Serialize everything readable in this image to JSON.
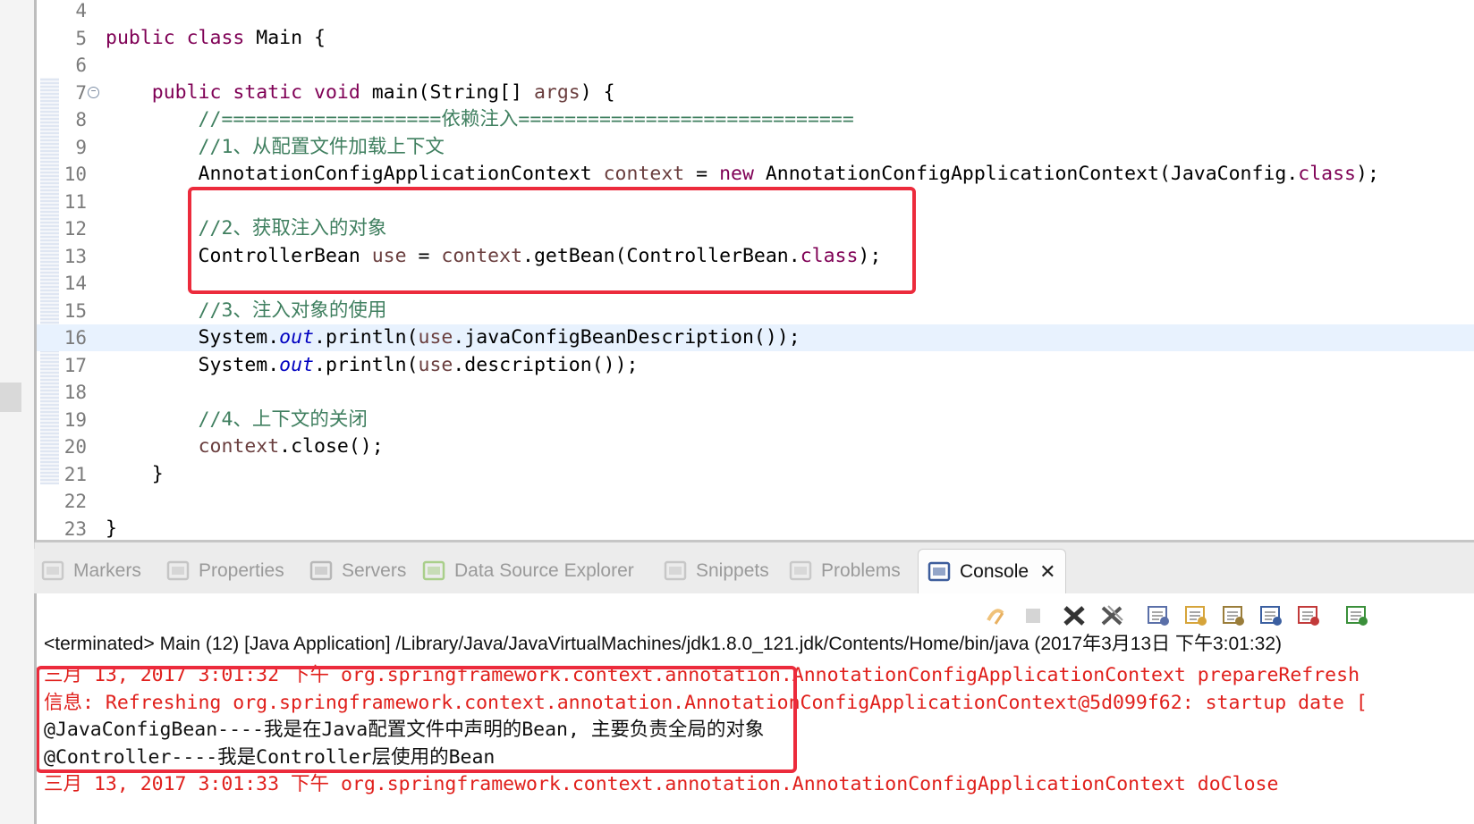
{
  "editor": {
    "lines": [
      {
        "num": "4",
        "segments": []
      },
      {
        "num": "5",
        "segments": [
          {
            "t": "public class ",
            "c": "kw"
          },
          {
            "t": "Main {",
            "c": ""
          }
        ]
      },
      {
        "num": "6",
        "segments": []
      },
      {
        "num": "7",
        "segments": [
          {
            "t": "    public static void ",
            "c": "kw"
          },
          {
            "t": "main(String[] ",
            "c": ""
          },
          {
            "t": "args",
            "c": "var"
          },
          {
            "t": ") {",
            "c": ""
          }
        ]
      },
      {
        "num": "8",
        "segments": [
          {
            "t": "        //===================依赖注入=============================",
            "c": "cm"
          }
        ]
      },
      {
        "num": "9",
        "segments": [
          {
            "t": "        //1、从配置文件加载上下文",
            "c": "cm"
          }
        ]
      },
      {
        "num": "10",
        "segments": [
          {
            "t": "        AnnotationConfigApplicationContext ",
            "c": ""
          },
          {
            "t": "context",
            "c": "var"
          },
          {
            "t": " = ",
            "c": ""
          },
          {
            "t": "new",
            "c": "kw"
          },
          {
            "t": " AnnotationConfigApplicationContext(JavaConfig.",
            "c": ""
          },
          {
            "t": "class",
            "c": "kw"
          },
          {
            "t": ");",
            "c": ""
          }
        ]
      },
      {
        "num": "11",
        "segments": []
      },
      {
        "num": "12",
        "segments": [
          {
            "t": "        //2、获取注入的对象",
            "c": "cm"
          }
        ]
      },
      {
        "num": "13",
        "segments": [
          {
            "t": "        ControllerBean ",
            "c": ""
          },
          {
            "t": "use",
            "c": "var"
          },
          {
            "t": " = ",
            "c": ""
          },
          {
            "t": "context",
            "c": "var"
          },
          {
            "t": ".getBean(ControllerBean.",
            "c": ""
          },
          {
            "t": "class",
            "c": "kw"
          },
          {
            "t": ");",
            "c": ""
          }
        ]
      },
      {
        "num": "14",
        "segments": []
      },
      {
        "num": "15",
        "segments": [
          {
            "t": "        //3、注入对象的使用",
            "c": "cm"
          }
        ]
      },
      {
        "num": "16",
        "segments": [
          {
            "t": "        System.",
            "c": ""
          },
          {
            "t": "out",
            "c": "fld"
          },
          {
            "t": ".println(",
            "c": ""
          },
          {
            "t": "use",
            "c": "var"
          },
          {
            "t": ".javaConfigBeanDescription());",
            "c": ""
          }
        ]
      },
      {
        "num": "17",
        "segments": [
          {
            "t": "        System.",
            "c": ""
          },
          {
            "t": "out",
            "c": "fld"
          },
          {
            "t": ".println(",
            "c": ""
          },
          {
            "t": "use",
            "c": "var"
          },
          {
            "t": ".description());",
            "c": ""
          }
        ]
      },
      {
        "num": "18",
        "segments": []
      },
      {
        "num": "19",
        "segments": [
          {
            "t": "        //4、上下文的关闭",
            "c": "cm"
          }
        ]
      },
      {
        "num": "20",
        "segments": [
          {
            "t": "        ",
            "c": ""
          },
          {
            "t": "context",
            "c": "var"
          },
          {
            "t": ".close();",
            "c": ""
          }
        ]
      },
      {
        "num": "21",
        "segments": [
          {
            "t": "    }",
            "c": ""
          }
        ]
      },
      {
        "num": "22",
        "segments": []
      },
      {
        "num": "23",
        "segments": [
          {
            "t": "}",
            "c": ""
          }
        ]
      }
    ],
    "current_line": "16",
    "fold_marker_line": "7",
    "fold_marker_glyph": "⊖"
  },
  "views": {
    "tabs": [
      {
        "label": "Markers",
        "icon": "markers-icon",
        "active": false
      },
      {
        "label": "Properties",
        "icon": "properties-icon",
        "active": false
      },
      {
        "label": "Servers",
        "icon": "servers-icon",
        "active": false
      },
      {
        "label": "Data Source Explorer",
        "icon": "data-source-icon",
        "active": false
      },
      {
        "label": "Snippets",
        "icon": "snippets-icon",
        "active": false
      },
      {
        "label": "Problems",
        "icon": "problems-icon",
        "active": false
      },
      {
        "label": "Console",
        "icon": "console-icon",
        "active": true
      }
    ],
    "close_glyph": "✕"
  },
  "console": {
    "terminated_line": "<terminated> Main (12) [Java Application] /Library/Java/JavaVirtualMachines/jdk1.8.0_121.jdk/Contents/Home/bin/java (2017年3月13日 下午3:01:32)",
    "lines": [
      {
        "text": "三月 13, 2017 3:01:32 下午 org.springframework.context.annotation.AnnotationConfigApplicationContext prepareRefresh",
        "color": "red"
      },
      {
        "text": "信息: Refreshing org.springframework.context.annotation.AnnotationConfigApplicationContext@5d099f62: startup date [",
        "color": "red"
      },
      {
        "text": "@JavaConfigBean----我是在Java配置文件中声明的Bean, 主要负责全局的对象",
        "color": "black"
      },
      {
        "text": "@Controller----我是Controller层使用的Bean",
        "color": "black"
      },
      {
        "text": "三月 13, 2017 3:01:33 下午 org.springframework.context.annotation.AnnotationConfigApplicationContext doClose",
        "color": "red"
      }
    ],
    "toolbar_icons": [
      "terminate-relaunch-icon",
      "stop-icon",
      "remove-launch-icon",
      "remove-all-terminated-icon",
      "clear-console-icon",
      "scroll-lock-icon",
      "word-wrap-icon",
      "show-on-stdout-icon",
      "show-on-stderr-icon",
      "pin-console-icon"
    ]
  },
  "colors": {
    "highlight_box": "#ec2b3c",
    "error_text": "#e0201c"
  }
}
